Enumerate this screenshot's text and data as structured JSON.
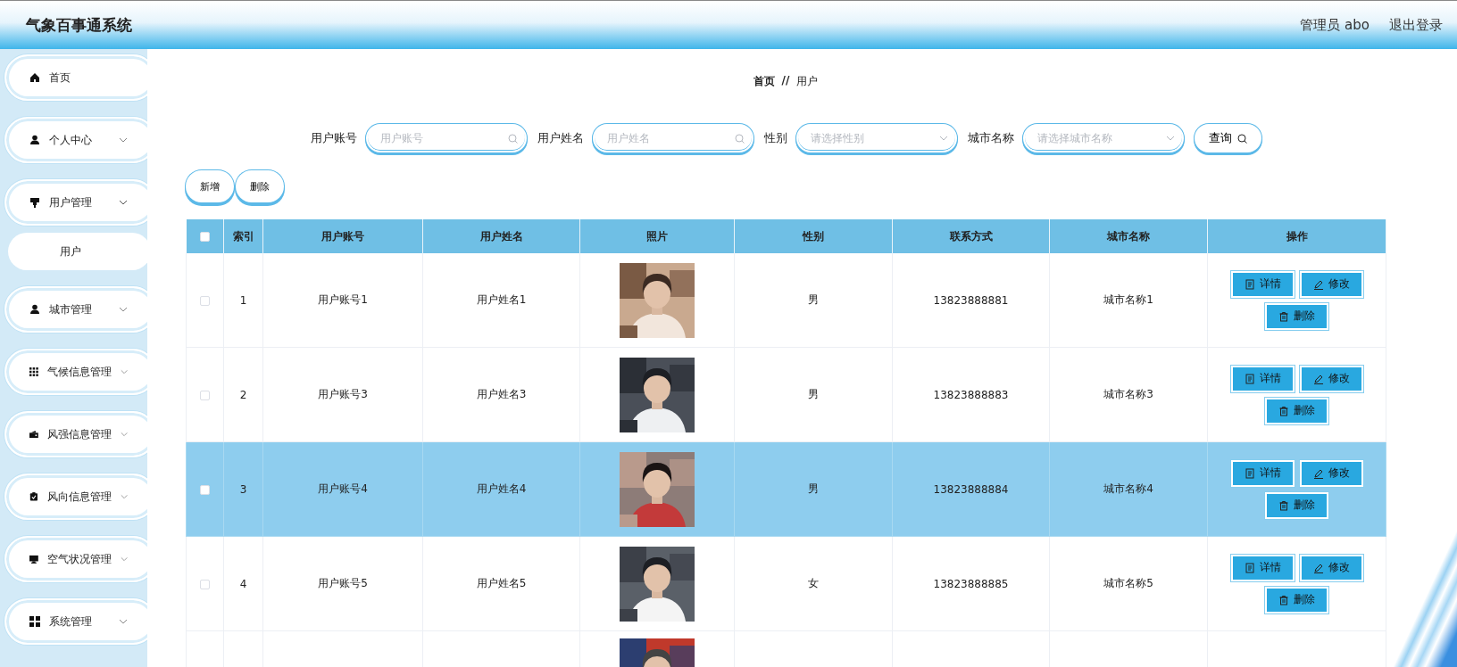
{
  "header": {
    "title": "气象百事通系统",
    "user": "管理员 abo",
    "logout": "退出登录"
  },
  "sidebar": {
    "items": [
      {
        "label": "首页",
        "kind": "link"
      },
      {
        "label": "个人中心",
        "kind": "group",
        "expanded": false
      },
      {
        "label": "用户管理",
        "kind": "group",
        "expanded": true,
        "children": [
          {
            "label": "用户"
          }
        ]
      },
      {
        "label": "城市管理",
        "kind": "group",
        "expanded": false
      },
      {
        "label": "气候信息管理",
        "kind": "group",
        "expanded": false
      },
      {
        "label": "风强信息管理",
        "kind": "group",
        "expanded": false
      },
      {
        "label": "风向信息管理",
        "kind": "group",
        "expanded": false
      },
      {
        "label": "空气状况管理",
        "kind": "group",
        "expanded": false
      },
      {
        "label": "系统管理",
        "kind": "group",
        "expanded": false
      }
    ]
  },
  "breadcrumb": {
    "items": [
      "首页",
      "用户"
    ],
    "separator": "//"
  },
  "search": {
    "fields": [
      {
        "label": "用户账号",
        "placeholder": "用户账号",
        "kind": "text"
      },
      {
        "label": "用户姓名",
        "placeholder": "用户姓名",
        "kind": "text"
      },
      {
        "label": "性别",
        "placeholder": "请选择性别",
        "kind": "select"
      },
      {
        "label": "城市名称",
        "placeholder": "请选择城市名称",
        "kind": "select"
      }
    ],
    "button": "查询"
  },
  "actions": [
    "新增",
    "删除"
  ],
  "table": {
    "header_checked": false,
    "columns": [
      "索引",
      "用户账号",
      "用户姓名",
      "照片",
      "性别",
      "联系方式",
      "城市名称",
      "操作"
    ],
    "rows": [
      {
        "index": "1",
        "account": "用户账号1",
        "name": "用户姓名1",
        "photo": {
          "kind": "picture"
        },
        "gender": "男",
        "phone": "13823888881",
        "city": "城市名称1",
        "checked": false,
        "selected": false,
        "actions": [
          "详情",
          "修改",
          "删除"
        ]
      },
      {
        "index": "2",
        "account": "用户账号3",
        "name": "用户姓名3",
        "photo": {
          "kind": "picture"
        },
        "gender": "男",
        "phone": "13823888883",
        "city": "城市名称3",
        "checked": false,
        "selected": false,
        "actions": [
          "详情",
          "修改",
          "删除"
        ]
      },
      {
        "index": "3",
        "account": "用户账号4",
        "name": "用户姓名4",
        "photo": {
          "kind": "picture"
        },
        "gender": "男",
        "phone": "13823888884",
        "city": "城市名称4",
        "checked": false,
        "selected": true,
        "actions": [
          "详情",
          "修改",
          "删除"
        ]
      },
      {
        "index": "4",
        "account": "用户账号5",
        "name": "用户姓名5",
        "photo": {
          "kind": "picture"
        },
        "gender": "女",
        "phone": "13823888885",
        "city": "城市名称5",
        "checked": false,
        "selected": false,
        "actions": [
          "详情",
          "修改",
          "删除"
        ]
      },
      {
        "photo": {
          "kind": "picture"
        }
      }
    ]
  }
}
